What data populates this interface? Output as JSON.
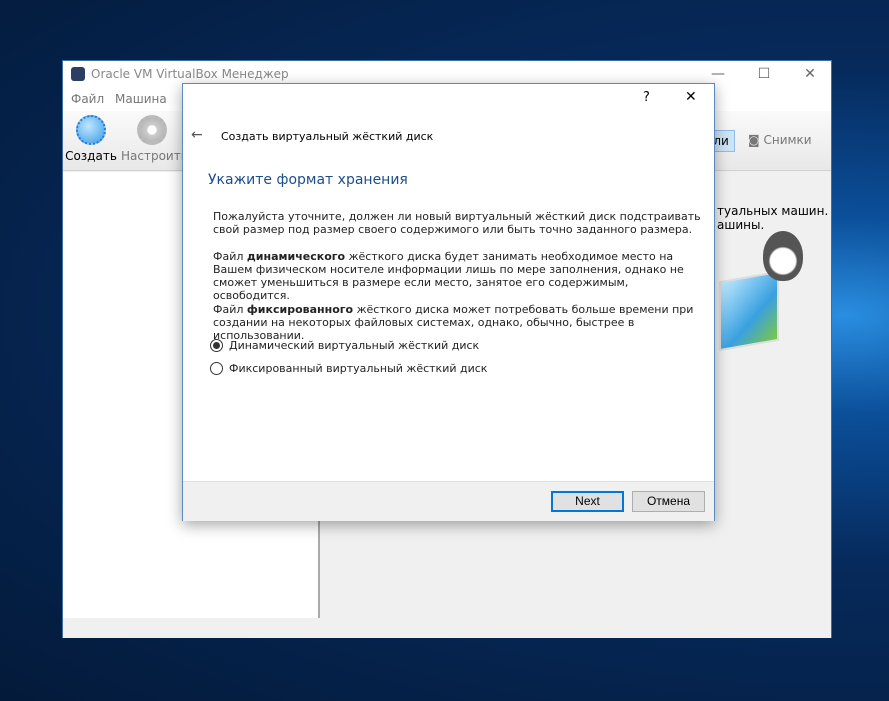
{
  "main_window": {
    "title": "Oracle VM VirtualBox Менеджер",
    "menu": [
      "Файл",
      "Машина"
    ],
    "toolbar": [
      {
        "label": "Создать",
        "icon": "new-vm-icon"
      },
      {
        "label": "Настроить",
        "icon": "settings-gear-icon"
      }
    ],
    "right_tabs": {
      "details_partial": "али",
      "snapshots": "Снимки"
    },
    "welcome_partial": [
      "туальных машин.",
      "ашины."
    ]
  },
  "dialog": {
    "help": "?",
    "close": "✕",
    "back": "←",
    "title": "Создать виртуальный жёсткий диск",
    "heading": "Укажите формат хранения",
    "p1": "Пожалуйста уточните, должен ли новый виртуальный жёсткий диск подстраивать свой размер под размер своего содержимого или быть точно заданного размера.",
    "p2_pre": "Файл ",
    "p2_bold": "динамического",
    "p2_post": " жёсткого диска будет занимать необходимое место на Вашем физическом носителе информации лишь по мере заполнения, однако не сможет уменьшиться в размере если место, занятое его содержимым, освободится.",
    "p3_pre": "Файл ",
    "p3_bold": "фиксированного",
    "p3_post": " жёсткого диска может потребовать больше времени при создании на некоторых файловых системах, однако, обычно, быстрее в использовании.",
    "options": [
      {
        "label": "Динамический виртуальный жёсткий диск",
        "selected": true
      },
      {
        "label": "Фиксированный виртуальный жёсткий диск",
        "selected": false
      }
    ],
    "next": "Next",
    "cancel": "Отмена"
  }
}
